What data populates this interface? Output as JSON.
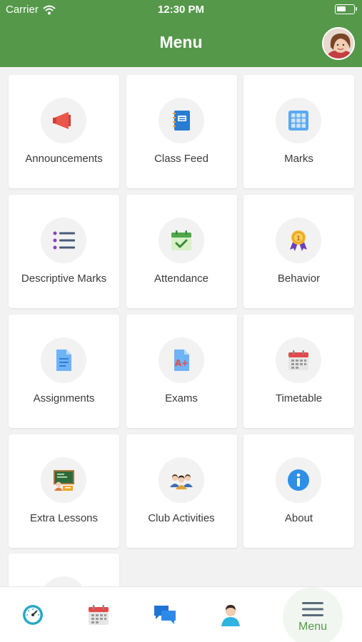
{
  "status_bar": {
    "carrier": "Carrier",
    "time": "12:30 PM",
    "battery_level": 0.55
  },
  "header": {
    "title": "Menu",
    "avatar_icon": "profile-photo"
  },
  "tiles": [
    {
      "label": "Announcements",
      "icon": "megaphone-icon"
    },
    {
      "label": "Class Feed",
      "icon": "notebook-icon"
    },
    {
      "label": "Marks",
      "icon": "grid-icon"
    },
    {
      "label": "Descriptive Marks",
      "icon": "bullet-list-icon"
    },
    {
      "label": "Attendance",
      "icon": "calendar-check-icon"
    },
    {
      "label": "Behavior",
      "icon": "medal-icon"
    },
    {
      "label": "Assignments",
      "icon": "document-icon"
    },
    {
      "label": "Exams",
      "icon": "graded-paper-icon"
    },
    {
      "label": "Timetable",
      "icon": "calendar-icon"
    },
    {
      "label": "Extra Lessons",
      "icon": "chalkboard-icon"
    },
    {
      "label": "Club Activities",
      "icon": "group-icon"
    },
    {
      "label": "About",
      "icon": "info-icon"
    }
  ],
  "tabbar": {
    "items": [
      {
        "icon": "dashboard-gauge-icon"
      },
      {
        "icon": "calendar-icon"
      },
      {
        "icon": "chat-bubbles-icon"
      },
      {
        "icon": "user-icon"
      }
    ],
    "menu_label": "Menu",
    "menu_icon": "hamburger-icon"
  },
  "colors": {
    "header": "#55984a",
    "accent": "#55984a",
    "background": "#f2f2f2"
  }
}
